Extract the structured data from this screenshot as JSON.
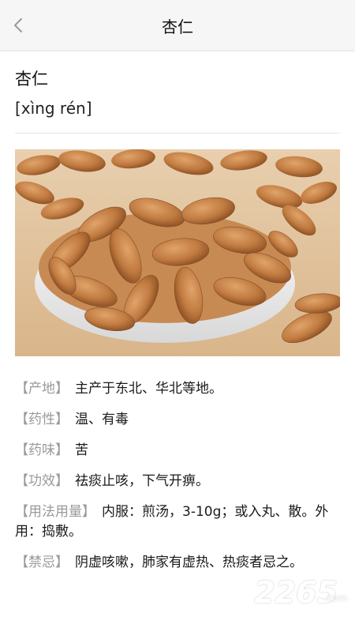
{
  "nav": {
    "title": "杏仁",
    "back_icon": "chevron-left-icon"
  },
  "herb": {
    "name": "杏仁",
    "pinyin": "[xìng rén]"
  },
  "image": {
    "subject": "almonds-photo"
  },
  "properties": [
    {
      "label": "【产地】",
      "value": "主产于东北、华北等地。"
    },
    {
      "label": "【药性】",
      "value": "温、有毒"
    },
    {
      "label": "【药味】",
      "value": "苦"
    },
    {
      "label": "【功效】",
      "value": "祛痰止咳，下气开痹。"
    },
    {
      "label": "【用法用量】",
      "value": "内服：煎汤，3-10g；或入丸、散。外用：捣敷。"
    },
    {
      "label": "【禁忌】",
      "value": "阴虚咳嗽，肺家有虚热、热痰者忌之。"
    }
  ],
  "watermark": {
    "main": "2265",
    "sub": ".com"
  },
  "colors": {
    "label": "#9a9a9a",
    "text": "#1a1a1a",
    "nav_bg": "#f6f6f6"
  }
}
